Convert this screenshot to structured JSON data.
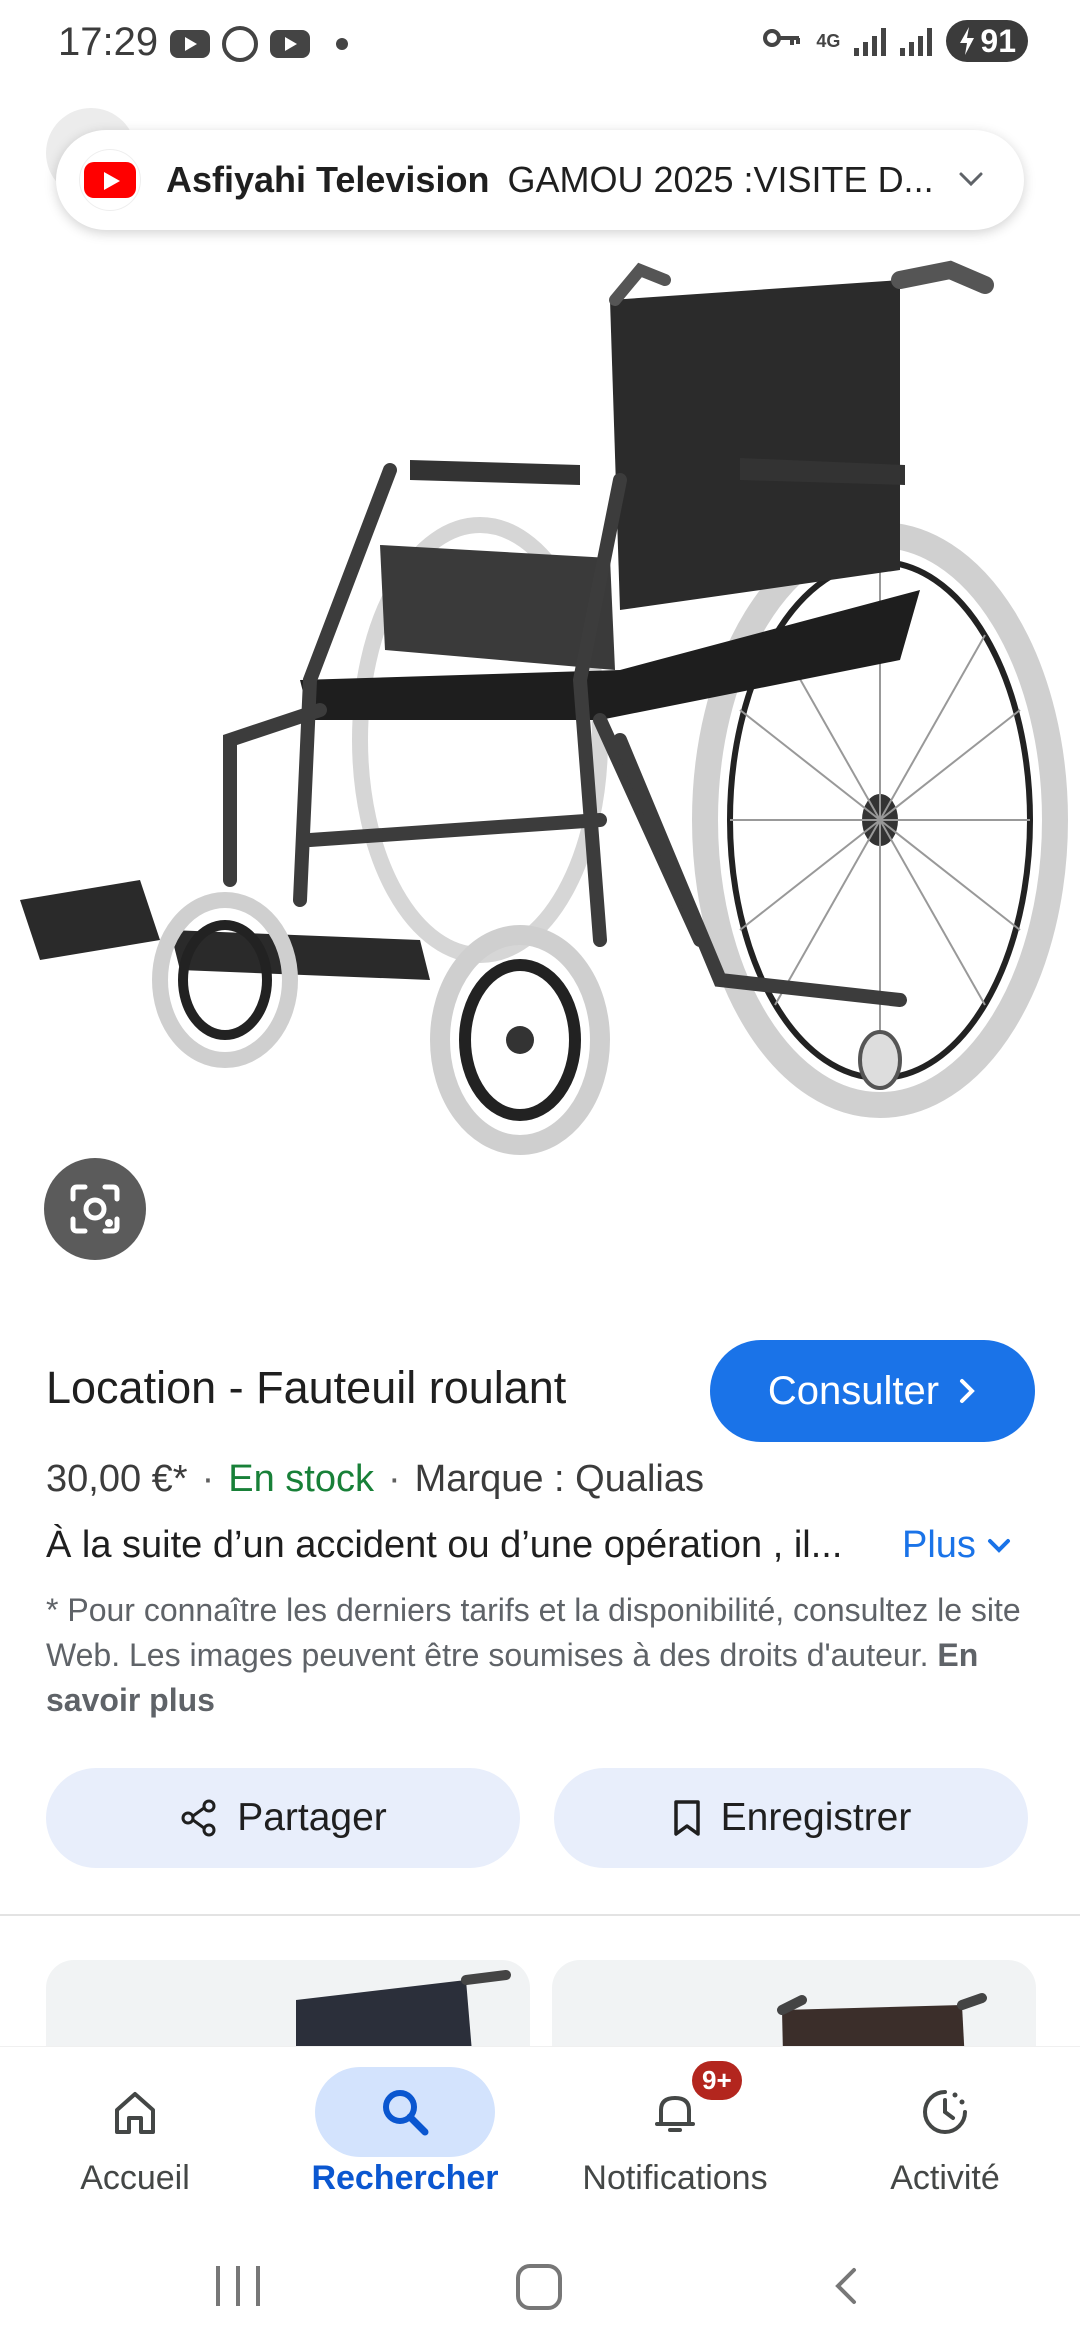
{
  "status_bar": {
    "time": "17:29",
    "network": "4G",
    "battery": "91",
    "icons": [
      "youtube-icon",
      "whatsapp-icon",
      "youtube-icon",
      "dot-icon",
      "vpn-key-icon",
      "signal-icon",
      "signal-icon",
      "battery-charging-icon"
    ]
  },
  "now_playing": {
    "channel": "Asfiyahi Television",
    "title": "GAMOU 2025 :VISITE D...",
    "app_icon": "youtube-icon",
    "expand_icon": "chevron-down-icon"
  },
  "product": {
    "title": "Location - Fauteuil roulant",
    "consult_label": "Consulter",
    "price": "30,00 €*",
    "stock": "En stock",
    "brand": "Marque : Qualias",
    "separator": "·",
    "description": "À la suite d’un accident ou d’une opération , il...",
    "more_label": "Plus",
    "disclaimer": "* Pour connaître les derniers tarifs et la disponibilité, consultez le site Web. Les images peuvent être soumises à des droits d'auteur.",
    "learn_more": "En savoir plus"
  },
  "actions": {
    "share_label": "Partager",
    "save_label": "Enregistrer"
  },
  "bottom_nav": {
    "items": [
      {
        "label": "Accueil",
        "icon": "home-icon"
      },
      {
        "label": "Rechercher",
        "icon": "search-icon"
      },
      {
        "label": "Notifications",
        "icon": "bell-icon"
      },
      {
        "label": "Activité",
        "icon": "activity-icon"
      }
    ],
    "notification_badge": "9+"
  },
  "colors": {
    "accent": "#1a73e8",
    "in_stock": "#188038",
    "active_nav_bg": "#d3e3fd",
    "action_bg": "#e8eefb",
    "badge": "#b3261e",
    "youtube_red": "#ff0000"
  }
}
